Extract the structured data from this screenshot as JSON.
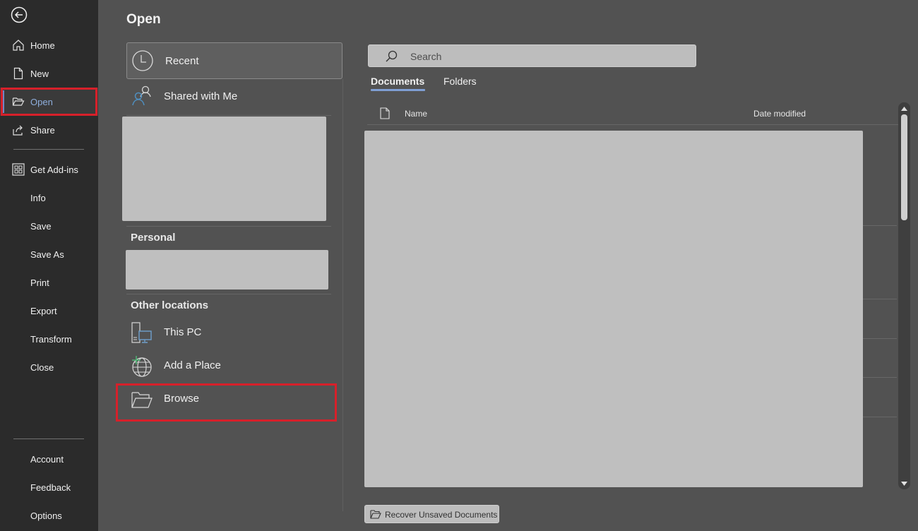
{
  "nav": {
    "back_icon": "back-arrow-icon",
    "items": [
      {
        "label": "Home",
        "icon": "home-icon"
      },
      {
        "label": "New",
        "icon": "new-document-icon"
      },
      {
        "label": "Open",
        "icon": "open-folder-icon",
        "active": true
      },
      {
        "label": "Share",
        "icon": "share-icon"
      },
      {
        "label": "Get Add-ins",
        "icon": "add-ins-icon"
      },
      {
        "label": "Info"
      },
      {
        "label": "Save"
      },
      {
        "label": "Save As"
      },
      {
        "label": "Print"
      },
      {
        "label": "Export"
      },
      {
        "label": "Transform"
      },
      {
        "label": "Close"
      },
      {
        "label": "Account"
      },
      {
        "label": "Feedback"
      },
      {
        "label": "Options"
      }
    ]
  },
  "page": {
    "title": "Open"
  },
  "locations": {
    "recent": {
      "label": "Recent",
      "icon": "clock-icon"
    },
    "shared": {
      "label": "Shared with Me",
      "icon": "shared-people-icon"
    },
    "personal_heading": "Personal",
    "other_heading": "Other locations",
    "this_pc": {
      "label": "This PC",
      "icon": "computer-icon"
    },
    "add_place": {
      "label": "Add a Place",
      "icon": "globe-add-icon"
    },
    "browse": {
      "label": "Browse",
      "icon": "folder-icon"
    }
  },
  "files": {
    "search_placeholder": "Search",
    "tabs": [
      {
        "label": "Documents",
        "active": true
      },
      {
        "label": "Folders"
      }
    ],
    "columns": {
      "name": "Name",
      "date": "Date modified"
    },
    "recover_button": "Recover Unsaved Documents"
  },
  "colors": {
    "highlight_border": "#d7202a",
    "accent": "#7f9fd4",
    "nav_bg": "#2b2b2b",
    "content_bg": "#525252"
  }
}
